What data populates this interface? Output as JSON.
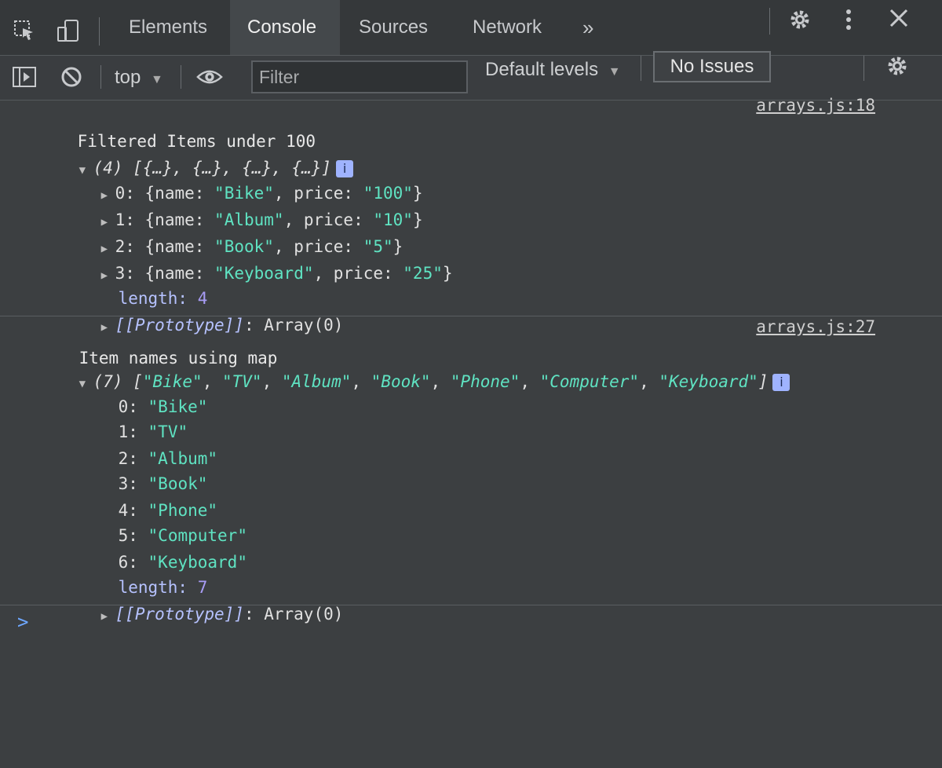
{
  "tabs": [
    {
      "label": "Elements"
    },
    {
      "label": "Console"
    },
    {
      "label": "Sources"
    },
    {
      "label": "Network"
    }
  ],
  "tabs_overflow": "»",
  "toolbar": {
    "context": "top",
    "filter_placeholder": "Filter",
    "levels": "Default levels",
    "issues": "No Issues"
  },
  "logs": [
    {
      "message": "Filtered Items under 100",
      "source": "arrays.js:18",
      "summary_count": "(4)",
      "summary": "[{…}, {…}, {…}, {…}]",
      "entries": [
        {
          "index": "0:",
          "name": "\"Bike\"",
          "price": "\"100\""
        },
        {
          "index": "1:",
          "name": "\"Album\"",
          "price": "\"10\""
        },
        {
          "index": "2:",
          "name": "\"Book\"",
          "price": "\"5\""
        },
        {
          "index": "3:",
          "name": "\"Keyboard\"",
          "price": "\"25\""
        }
      ],
      "length_label": "length:",
      "length_value": "4",
      "prototype": "[[Prototype]]",
      "prototype_value": ": Array(0)"
    },
    {
      "message": "Item names using map",
      "source": "arrays.js:27",
      "summary_count": "(7)",
      "summary_items": [
        "\"Bike\"",
        "\"TV\"",
        "\"Album\"",
        "\"Book\"",
        "\"Phone\"",
        "\"Computer\"",
        "\"Keyboard\""
      ],
      "entries": [
        {
          "index": "0:",
          "value": "\"Bike\""
        },
        {
          "index": "1:",
          "value": "\"TV\""
        },
        {
          "index": "2:",
          "value": "\"Album\""
        },
        {
          "index": "3:",
          "value": "\"Book\""
        },
        {
          "index": "4:",
          "value": "\"Phone\""
        },
        {
          "index": "5:",
          "value": "\"Computer\""
        },
        {
          "index": "6:",
          "value": "\"Keyboard\""
        }
      ],
      "length_label": "length:",
      "length_value": "7",
      "prototype": "[[Prototype]]",
      "prototype_value": ": Array(0)"
    }
  ],
  "prompt": ">",
  "colors": {
    "string": "#5fe3c2",
    "number": "#a89cf5",
    "accent": "#6ea7ff"
  }
}
